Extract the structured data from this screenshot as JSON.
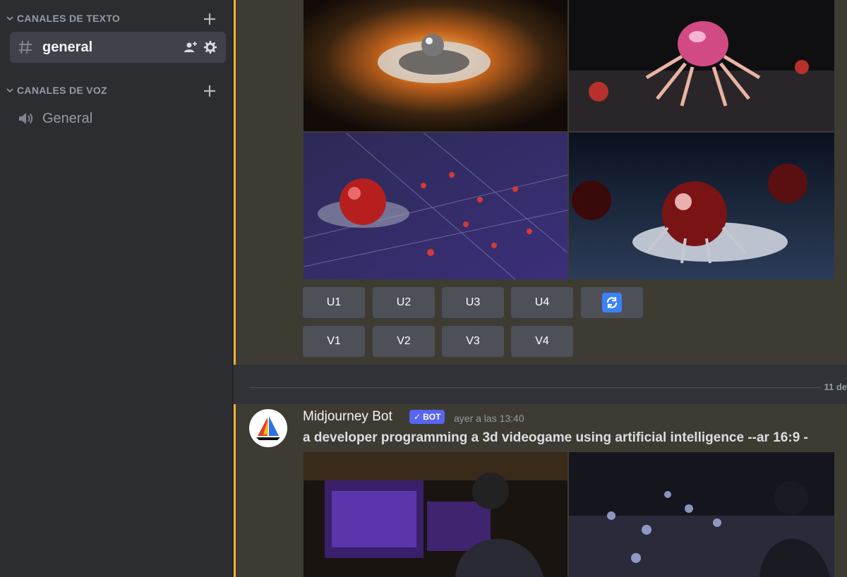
{
  "sidebar": {
    "text_category": "CANALES DE TEXTO",
    "voice_category": "CANALES DE VOZ",
    "text_channels": [
      {
        "name": "general",
        "icon": "hash-icon",
        "active": true
      }
    ],
    "voice_channels": [
      {
        "name": "General",
        "icon": "speaker-icon"
      }
    ]
  },
  "upscale_buttons": [
    "U1",
    "U2",
    "U3",
    "U4"
  ],
  "variation_buttons": [
    "V1",
    "V2",
    "V3",
    "V4"
  ],
  "reroll_icon": "refresh-icon",
  "date_divider": "11 de",
  "message": {
    "author": "Midjourney Bot",
    "badge": "BOT",
    "timestamp": "ayer a las 13:40",
    "prompt": "a developer programming a 3d videogame using artificial intelligence --ar 16:9 -"
  },
  "colors": {
    "accent": "#f0b232",
    "bot_badge": "#5865f2",
    "button": "#4e5058",
    "highlight": "#3e3b33"
  }
}
